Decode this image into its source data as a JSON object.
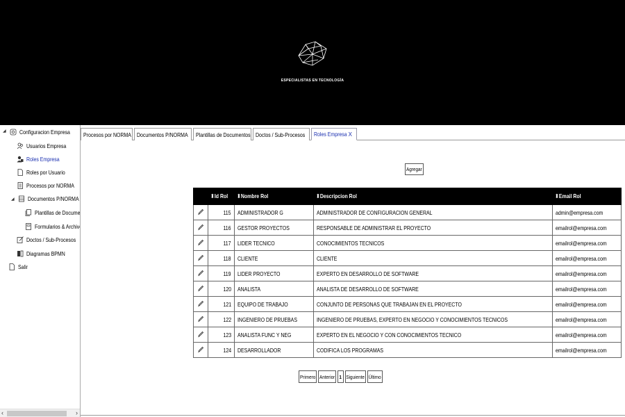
{
  "header": {
    "tagline": "ESPECIALISTAS EN TECNOLOGÍA"
  },
  "sidebar": {
    "items": [
      {
        "label": "Configuracion Empresa",
        "icon": "settings-icon"
      },
      {
        "label": "Usuarios Empresa",
        "icon": "users-icon"
      },
      {
        "label": "Roles Empresa",
        "icon": "roles-icon",
        "active": true
      },
      {
        "label": "Roles por Usuario",
        "icon": "document-icon"
      },
      {
        "label": "Procesos por NORMA",
        "icon": "list-document-icon"
      },
      {
        "label": "Documentos P/NORMA",
        "icon": "folder-icon"
      },
      {
        "label": "Plantillas de Documentos",
        "icon": "template-icon"
      },
      {
        "label": "Formularios & Archivos",
        "icon": "form-icon"
      },
      {
        "label": "Doctos / Sub-Procesos",
        "icon": "edit-document-icon"
      },
      {
        "label": "Diagramas BPMN",
        "icon": "diagram-icon"
      },
      {
        "label": "Salir",
        "icon": "exit-document-icon"
      }
    ]
  },
  "tabs": [
    {
      "label": "Procesos por NORMA"
    },
    {
      "label": "Documentos P/NORMA"
    },
    {
      "label": "Plantillas de Documentos"
    },
    {
      "label": "Doctos / Sub-Procesos"
    },
    {
      "label": "Roles Empresa",
      "close": "X",
      "active": true
    }
  ],
  "main": {
    "add_button": "Agregar",
    "table": {
      "columns": [
        "",
        "Id Rol",
        "Nombre Rol",
        "Descripcion Rol",
        "Email Rol"
      ],
      "sort_glyph": "⬍",
      "rows": [
        {
          "id": "115",
          "name": "ADMINISTRADOR G",
          "desc": "ADMINISTRADOR DE CONFIGURACION GENERAL",
          "email": "admin@empresa.com"
        },
        {
          "id": "116",
          "name": "GESTOR PROYECTOS",
          "desc": "RESPONSABLE DE ADMINISTRAR EL PROYECTO",
          "email": "emailrol@empresa.com"
        },
        {
          "id": "117",
          "name": "LIDER TECNICO",
          "desc": "CONOCIMIENTOS TECNICOS",
          "email": "emailrol@empresa.com"
        },
        {
          "id": "118",
          "name": "CLIENTE",
          "desc": "CLIENTE",
          "email": "emailrol@empresa.com"
        },
        {
          "id": "119",
          "name": "LIDER PROYECTO",
          "desc": "EXPERTO EN DESARROLLO DE SOFTWARE",
          "email": "emailrol@empresa.com"
        },
        {
          "id": "120",
          "name": "ANALISTA",
          "desc": "ANALISTA DE DESARROLLO DE SOFTWARE",
          "email": "emailrol@empresa.com"
        },
        {
          "id": "121",
          "name": "EQUIPO DE TRABAJO",
          "desc": "CONJUNTO DE PERSONAS QUE TRABAJAN EN EL PROYECTO",
          "email": "emailrol@empresa.com"
        },
        {
          "id": "122",
          "name": "INGENIERO DE PRUEBAS",
          "desc": "INGENIERO DE PRUEBAS, EXPERTO EN NEGOCIO Y CONOCIMIENTOS TECNICOS",
          "email": "emailrol@empresa.com"
        },
        {
          "id": "123",
          "name": "ANALISTA FUNC Y NEG",
          "desc": "EXPERTO EN EL NEGOCIO Y CON CONOCIMIENTOS TECNICO",
          "email": "emailrol@empresa.com"
        },
        {
          "id": "124",
          "name": "DESARROLLADOR",
          "desc": "CODIFICA LOS PROGRAMAS",
          "email": "emailrol@empresa.com"
        }
      ]
    },
    "pager": {
      "first": "Primero",
      "prev": "Anterior",
      "current": "1",
      "next": "Siguiente",
      "last": "Último"
    }
  },
  "scrollbar": {
    "left_arrow": "‹",
    "right_arrow": "›"
  }
}
